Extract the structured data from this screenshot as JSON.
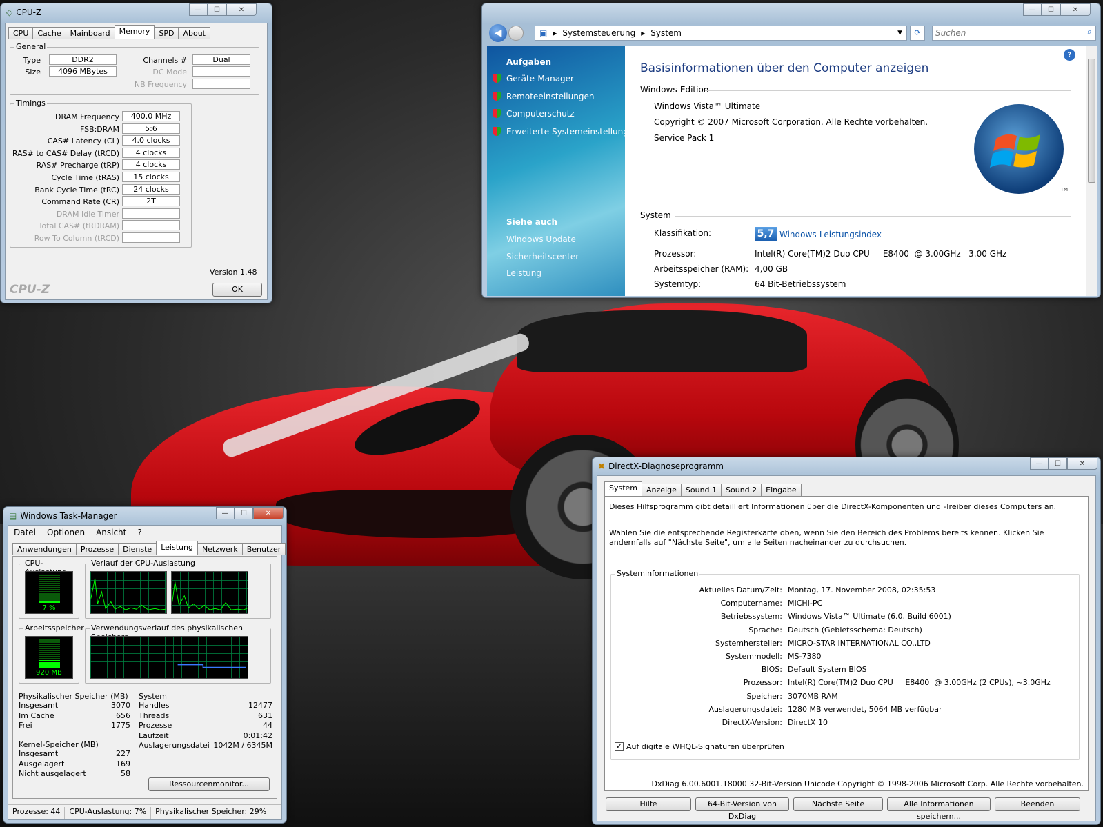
{
  "cpuz": {
    "title": "CPU-Z",
    "tabs": [
      "CPU",
      "Cache",
      "Mainboard",
      "Memory",
      "SPD",
      "About"
    ],
    "general_label": "General",
    "type_label": "Type",
    "type_value": "DDR2",
    "size_label": "Size",
    "size_value": "4096 MBytes",
    "channels_label": "Channels #",
    "channels_value": "Dual",
    "dcmode_label": "DC Mode",
    "nbfreq_label": "NB Frequency",
    "timings_label": "Timings",
    "timings": [
      {
        "label": "DRAM Frequency",
        "value": "400.0 MHz"
      },
      {
        "label": "FSB:DRAM",
        "value": "5:6"
      },
      {
        "label": "CAS# Latency (CL)",
        "value": "4.0 clocks"
      },
      {
        "label": "RAS# to CAS# Delay (tRCD)",
        "value": "4 clocks"
      },
      {
        "label": "RAS# Precharge (tRP)",
        "value": "4 clocks"
      },
      {
        "label": "Cycle Time (tRAS)",
        "value": "15 clocks"
      },
      {
        "label": "Bank Cycle Time (tRC)",
        "value": "24 clocks"
      },
      {
        "label": "Command Rate (CR)",
        "value": "2T"
      },
      {
        "label": "DRAM Idle Timer",
        "value": ""
      },
      {
        "label": "Total CAS# (tRDRAM)",
        "value": ""
      },
      {
        "label": "Row To Column (tRCD)",
        "value": ""
      }
    ],
    "version": "Version 1.48",
    "logo": "CPU-Z",
    "ok": "OK"
  },
  "sysprops": {
    "breadcrumb1": "Systemsteuerung",
    "breadcrumb2": "System",
    "search_placeholder": "Suchen",
    "tasks_heading": "Aufgaben",
    "tasks": [
      "Geräte-Manager",
      "Remoteeinstellungen",
      "Computerschutz",
      "Erweiterte Systemeinstellungen"
    ],
    "see_also_heading": "Siehe auch",
    "see_also": [
      "Windows Update",
      "Sicherheitscenter",
      "Leistung"
    ],
    "title": "Basisinformationen über den Computer anzeigen",
    "edition_heading": "Windows-Edition",
    "edition": "Windows Vista™ Ultimate",
    "copyright": "Copyright © 2007 Microsoft Corporation. Alle Rechte vorbehalten.",
    "sp": "Service Pack 1",
    "system_heading": "System",
    "rating_label": "Klassifikation:",
    "rating_score": "5,7",
    "rating_link": "Windows-Leistungsindex",
    "cpu_label": "Prozessor:",
    "cpu_value": "Intel(R) Core(TM)2 Duo CPU     E8400  @ 3.00GHz   3.00 GHz",
    "ram_label": "Arbeitsspeicher (RAM):",
    "ram_value": "4,00 GB",
    "type_label": "Systemtyp:",
    "type_value": "64 Bit-Betriebssystem",
    "tm": "TM"
  },
  "taskmgr": {
    "title": "Windows Task-Manager",
    "menu": [
      "Datei",
      "Optionen",
      "Ansicht",
      "?"
    ],
    "tabs": [
      "Anwendungen",
      "Prozesse",
      "Dienste",
      "Leistung",
      "Netzwerk",
      "Benutzer"
    ],
    "cpu_usage_label": "CPU-Auslastung",
    "cpu_usage": "7 %",
    "cpu_usage_pct": 7,
    "cpu_hist_label": "Verlauf der CPU-Auslastung",
    "mem_label": "Arbeitsspeicher",
    "mem_value": "920 MB",
    "mem_hist_label": "Verwendungsverlauf des physikalischen Speichers",
    "phys_label": "Physikalischer Speicher (MB)",
    "phys": [
      {
        "k": "Insgesamt",
        "v": "3070"
      },
      {
        "k": "Im Cache",
        "v": "656"
      },
      {
        "k": "Frei",
        "v": "1775"
      }
    ],
    "kernel_label": "Kernel-Speicher (MB)",
    "kernel": [
      {
        "k": "Insgesamt",
        "v": "227"
      },
      {
        "k": "Ausgelagert",
        "v": "169"
      },
      {
        "k": "Nicht ausgelagert",
        "v": "58"
      }
    ],
    "system_label": "System",
    "system": [
      {
        "k": "Handles",
        "v": "12477"
      },
      {
        "k": "Threads",
        "v": "631"
      },
      {
        "k": "Prozesse",
        "v": "44"
      },
      {
        "k": "Laufzeit",
        "v": "0:01:42"
      },
      {
        "k": "Auslagerungsdatei",
        "v": "1042M / 6345M"
      }
    ],
    "resmon": "Ressourcenmonitor...",
    "status": [
      "Prozesse: 44",
      "CPU-Auslastung: 7%",
      "Physikalischer Speicher: 29%"
    ]
  },
  "dxdiag": {
    "title": "DirectX-Diagnoseprogramm",
    "tabs": [
      "System",
      "Anzeige",
      "Sound 1",
      "Sound 2",
      "Eingabe"
    ],
    "intro": "Dieses Hilfsprogramm gibt detailliert Informationen über die DirectX-Komponenten und -Treiber dieses Computers an.",
    "intro2": "Wählen Sie die entsprechende Registerkarte oben, wenn Sie den Bereich des Problems bereits kennen. Klicken Sie andernfalls auf \"Nächste Seite\", um alle Seiten nacheinander zu durchsuchen.",
    "sysinfo_label": "Systeminformationen",
    "rows": [
      {
        "k": "Aktuelles Datum/Zeit:",
        "v": "Montag, 17. November 2008, 02:35:53"
      },
      {
        "k": "Computername:",
        "v": "MICHI-PC"
      },
      {
        "k": "Betriebssystem:",
        "v": "Windows Vista™ Ultimate (6.0, Build 6001)"
      },
      {
        "k": "Sprache:",
        "v": "Deutsch (Gebietsschema: Deutsch)"
      },
      {
        "k": "Systemhersteller:",
        "v": "MICRO-STAR INTERNATIONAL CO.,LTD"
      },
      {
        "k": "Systemmodell:",
        "v": "MS-7380"
      },
      {
        "k": "BIOS:",
        "v": "Default System BIOS"
      },
      {
        "k": "Prozessor:",
        "v": "Intel(R) Core(TM)2 Duo CPU     E8400  @ 3.00GHz (2 CPUs), ~3.0GHz"
      },
      {
        "k": "Speicher:",
        "v": "3070MB RAM"
      },
      {
        "k": "Auslagerungsdatei:",
        "v": "1280 MB verwendet, 5064 MB verfügbar"
      },
      {
        "k": "DirectX-Version:",
        "v": "DirectX 10"
      }
    ],
    "whql": "Auf digitale WHQL-Signaturen überprüfen",
    "footer": "DxDiag 6.00.6001.18000 32-Bit-Version Unicode Copyright © 1998-2006 Microsoft Corp. Alle Rechte vorbehalten.",
    "buttons": [
      "Hilfe",
      "64-Bit-Version von DxDiag",
      "Nächste Seite",
      "Alle Informationen speichern...",
      "Beenden"
    ]
  },
  "colors": {
    "vista_blue": "#0b53a8",
    "graph_green": "#00ff00",
    "car_red": "#c8101a"
  }
}
